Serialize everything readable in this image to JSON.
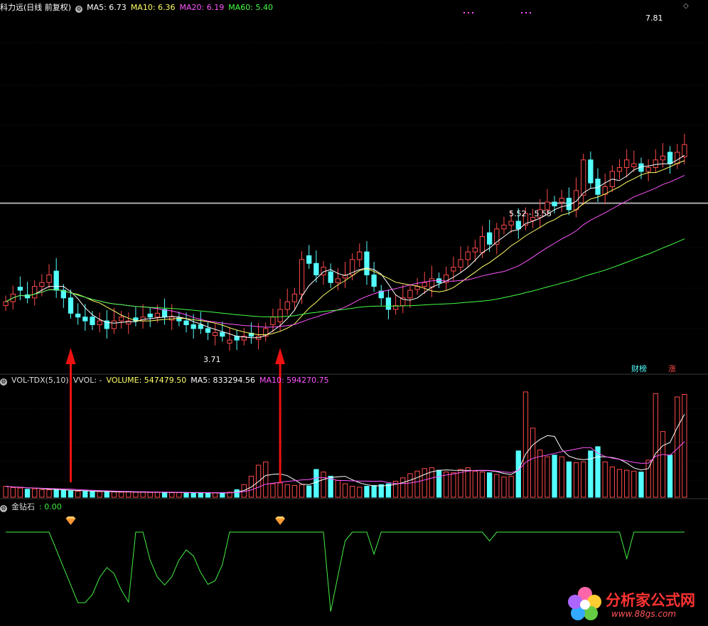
{
  "price_panel": {
    "stock_label": "科力远(日线 前复权)",
    "indicators": [
      {
        "text": "MA5: 6.73",
        "color": "#ffffff"
      },
      {
        "text": "MA10: 6.36",
        "color": "#ffff66"
      },
      {
        "text": "MA20: 6.19",
        "color": "#ff55ff"
      },
      {
        "text": "MA60: 5.40",
        "color": "#44ff44"
      }
    ],
    "high_label": "7.81",
    "low_label": "3.71",
    "range_label": "5.52 - 5.55",
    "tag_fund": "财榜",
    "tag_rise": "涨"
  },
  "volume_panel": {
    "indicator_name": "VOL-TDX(5,10)",
    "vvol": "VVOL: -",
    "volume": "VOLUME: 547479.50",
    "ma5": "MA5: 833294.56",
    "ma10": "MA10: 594270.75"
  },
  "diamond_panel": {
    "name": "金钻石",
    "value": ": 0.00"
  },
  "watermark": {
    "title": "分析家公式网",
    "url": "www.88gs.com"
  },
  "colors": {
    "up": "#ff4a4a",
    "down": "#54ffff",
    "ma5": "#ffffff",
    "ma10": "#ffff66",
    "ma20": "#ff55ff",
    "ma60": "#44ff44",
    "signal": "#44ee44",
    "arrow": "#ee1111"
  },
  "chart_data": {
    "type": "candlestick",
    "n_bars": 95,
    "price_range": [
      3.5,
      8.0
    ],
    "closes": [
      4.25,
      4.35,
      4.4,
      4.3,
      4.45,
      4.5,
      4.6,
      4.4,
      4.3,
      4.1,
      4.05,
      4.0,
      3.95,
      4.0,
      3.9,
      4.0,
      4.05,
      4.0,
      4.0,
      4.05,
      4.05,
      4.1,
      4.05,
      4.05,
      4.0,
      3.95,
      3.9,
      3.9,
      3.85,
      3.85,
      3.8,
      3.75,
      3.75,
      3.8,
      3.8,
      3.8,
      3.9,
      4.05,
      4.15,
      4.25,
      4.35,
      4.8,
      4.75,
      4.6,
      4.7,
      4.5,
      4.55,
      4.6,
      4.8,
      4.9,
      4.6,
      4.45,
      4.3,
      4.15,
      4.2,
      4.3,
      4.4,
      4.45,
      4.5,
      4.55,
      4.5,
      4.6,
      4.7,
      4.8,
      4.9,
      4.95,
      5.1,
      5.0,
      5.2,
      5.25,
      5.3,
      5.2,
      5.4,
      5.35,
      5.45,
      5.55,
      5.5,
      5.6,
      5.45,
      5.7,
      6.1,
      5.8,
      5.65,
      5.75,
      5.95,
      6.0,
      6.1,
      6.05,
      5.95,
      6.0,
      6.1,
      6.15,
      6.05,
      6.2,
      6.3
    ],
    "volume_range": [
      0,
      1300000
    ],
    "volumes": [
      130000,
      115000,
      110000,
      95000,
      100000,
      90000,
      88000,
      85000,
      80000,
      75000,
      72000,
      70000,
      68000,
      66000,
      64000,
      63000,
      60000,
      62000,
      61000,
      60000,
      58000,
      57000,
      56000,
      55000,
      55000,
      54000,
      53000,
      52000,
      52000,
      52000,
      51000,
      60000,
      90000,
      150000,
      250000,
      380000,
      420000,
      160000,
      170000,
      150000,
      140000,
      150000,
      135000,
      330000,
      300000,
      250000,
      200000,
      160000,
      130000,
      120000,
      130000,
      140000,
      150000,
      160000,
      190000,
      230000,
      280000,
      310000,
      340000,
      350000,
      320000,
      300000,
      290000,
      330000,
      350000,
      310000,
      300000,
      290000,
      270000,
      240000,
      250000,
      550000,
      1250000,
      820000,
      560000,
      480000,
      500000,
      480000,
      420000,
      410000,
      420000,
      550000,
      600000,
      420000,
      360000,
      330000,
      320000,
      310000,
      300000,
      440000,
      1230000,
      780000,
      500000,
      1190000,
      1220000
    ],
    "signal_range": [
      -10,
      1
    ],
    "signal_note": "",
    "diamond_markers_at_bar": [
      9,
      38
    ],
    "arrows_at_bar": [
      9,
      38
    ]
  }
}
